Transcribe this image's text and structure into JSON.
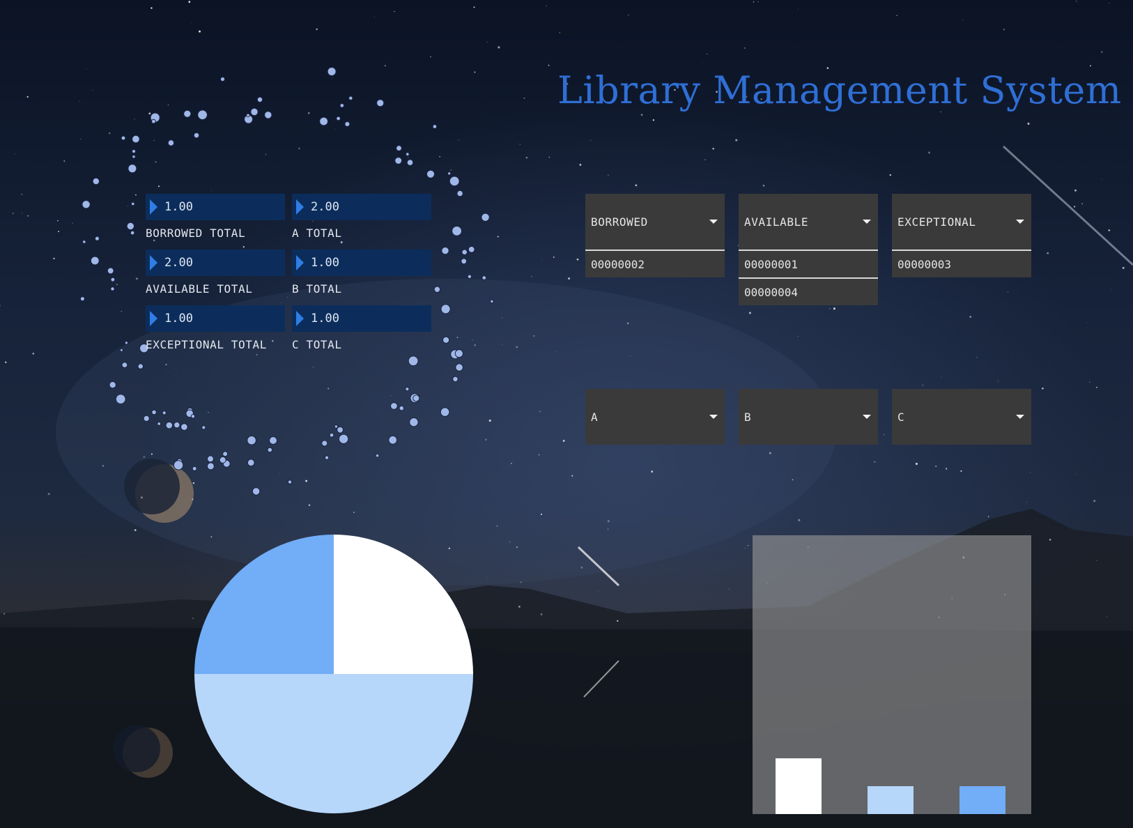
{
  "app": {
    "title": "Library Management System"
  },
  "stats": {
    "borrowed_total": {
      "value": "1.00",
      "label": "BORROWED TOTAL"
    },
    "a_total": {
      "value": "2.00",
      "label": "A TOTAL"
    },
    "available_total": {
      "value": "2.00",
      "label": "AVAILABLE TOTAL"
    },
    "b_total": {
      "value": "1.00",
      "label": "B TOTAL"
    },
    "exceptional_total": {
      "value": "1.00",
      "label": "EXCEPTIONAL TOTAL"
    },
    "c_total": {
      "value": "1.00",
      "label": "C TOTAL"
    }
  },
  "status_dropdowns": [
    {
      "label": "BORROWED",
      "items": [
        "00000002"
      ]
    },
    {
      "label": "AVAILABLE",
      "items": [
        "00000001",
        "00000004"
      ]
    },
    {
      "label": "EXCEPTIONAL",
      "items": [
        "00000003"
      ]
    }
  ],
  "category_dropdowns": [
    {
      "label": "A"
    },
    {
      "label": "B"
    },
    {
      "label": "C"
    }
  ],
  "colors": {
    "accent": "#2f6fd6",
    "stat_bg": "#0c2d5b",
    "dropdown_bg": "#3a3a3a",
    "series_white": "#ffffff",
    "series_light": "#b6d6fa",
    "series_mid": "#72adf7"
  },
  "chart_data": [
    {
      "type": "pie",
      "title": "",
      "slices": [
        {
          "value": 1,
          "color": "#ffffff"
        },
        {
          "value": 2,
          "color": "#b6d6fa"
        },
        {
          "value": 1,
          "color": "#72adf7"
        }
      ]
    },
    {
      "type": "bar",
      "title": "",
      "categories": [
        "",
        "",
        ""
      ],
      "values": [
        2,
        1,
        1
      ],
      "colors": [
        "#ffffff",
        "#b6d6fa",
        "#72adf7"
      ],
      "ylim": [
        0,
        10
      ]
    }
  ]
}
